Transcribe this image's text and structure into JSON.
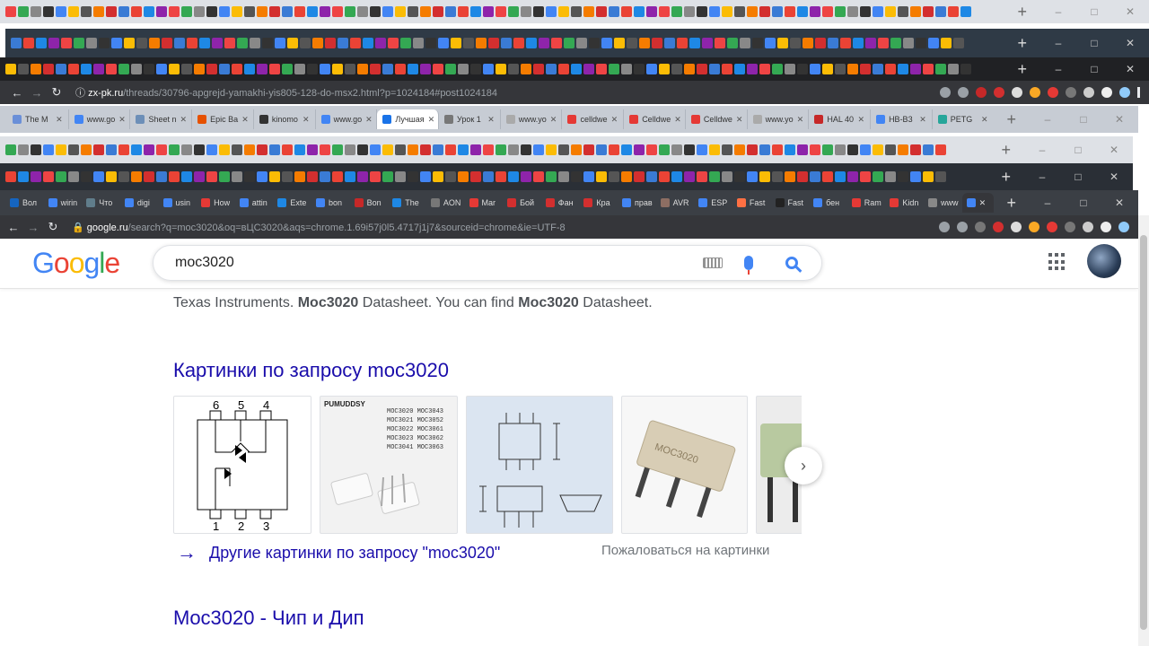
{
  "windows": {
    "top_strip_colors": [
      "#e44",
      "#3a7bd5",
      "#fbbc05",
      "#34a853",
      "#ea4335",
      "#555",
      "#888",
      "#1e88e5",
      "#f57c00",
      "#333",
      "#8e24aa",
      "#d32f2f",
      "#4285f4"
    ],
    "zxpk": {
      "url_host": "zx-pk.ru",
      "url_rest": "/threads/30796-apgrejd-yamakhi-yis805-128-do-msx2.html?p=1024184#post1024184"
    },
    "tabs_row": [
      {
        "label": "The M",
        "color": "#6a8fd8"
      },
      {
        "label": "www.go",
        "color": "#4285f4"
      },
      {
        "label": "Sheet n",
        "color": "#6d8fb8"
      },
      {
        "label": "Epic Ba",
        "color": "#e65100"
      },
      {
        "label": "kinomo",
        "color": "#333"
      },
      {
        "label": "www.go",
        "color": "#4285f4"
      },
      {
        "label": "Лучшая",
        "color": "#1a73e8",
        "active": true
      },
      {
        "label": "Урок 1",
        "color": "#777"
      },
      {
        "label": "www.yo",
        "color": "#aaa"
      },
      {
        "label": "celldwe",
        "color": "#e53935"
      },
      {
        "label": "Celldwe",
        "color": "#e53935"
      },
      {
        "label": "Celldwe",
        "color": "#e53935"
      },
      {
        "label": "www.yo",
        "color": "#aaa"
      },
      {
        "label": "HAL 40",
        "color": "#c62828"
      },
      {
        "label": "HB-B3",
        "color": "#4285f4"
      },
      {
        "label": "PETG",
        "color": "#26a69a"
      }
    ],
    "last_tabs": [
      {
        "label": "Вол",
        "color": "#1565c0"
      },
      {
        "label": "wirin",
        "color": "#4285f4"
      },
      {
        "label": "Что",
        "color": "#607d8b"
      },
      {
        "label": "digi",
        "color": "#4285f4"
      },
      {
        "label": "usin",
        "color": "#4285f4"
      },
      {
        "label": "How",
        "color": "#e53935"
      },
      {
        "label": "attin",
        "color": "#4285f4"
      },
      {
        "label": "Exte",
        "color": "#1e88e5"
      },
      {
        "label": "bon",
        "color": "#4285f4"
      },
      {
        "label": "Bon",
        "color": "#c62828"
      },
      {
        "label": "The",
        "color": "#1e88e5"
      },
      {
        "label": "AON",
        "color": "#777"
      },
      {
        "label": "Mar",
        "color": "#e53935"
      },
      {
        "label": "Бой",
        "color": "#d32f2f"
      },
      {
        "label": "Фан",
        "color": "#d32f2f"
      },
      {
        "label": "Кра",
        "color": "#d32f2f"
      },
      {
        "label": "прав",
        "color": "#4285f4"
      },
      {
        "label": "AVR",
        "color": "#8d6e63"
      },
      {
        "label": "ESP",
        "color": "#4285f4"
      },
      {
        "label": "Fast",
        "color": "#ff7043"
      },
      {
        "label": "Fast",
        "color": "#222"
      },
      {
        "label": "бен",
        "color": "#4285f4"
      },
      {
        "label": "Ram",
        "color": "#e53935"
      },
      {
        "label": "Kidn",
        "color": "#e53935"
      },
      {
        "label": "www",
        "color": "#888"
      }
    ],
    "google_url_host": "google.ru",
    "google_url_rest": "/search?q=moc3020&oq=вЦС3020&aqs=chrome.1.69i57j0l5.4717j1j7&sourceid=chrome&ie=UTF-8"
  },
  "google": {
    "logo": [
      "G",
      "o",
      "o",
      "g",
      "l",
      "e"
    ],
    "query": "moc3020",
    "snippet_pre": "Texas Instruments. ",
    "snippet_b1": "Moc3020",
    "snippet_mid": " Datasheet. You can find ",
    "snippet_b2": "Moc3020",
    "snippet_post": " Datasheet.",
    "images_heading": "Картинки по запросу moc3020",
    "thumb1_pins_top": [
      "6",
      "5",
      "4"
    ],
    "thumb1_pins_bottom": [
      "1",
      "2",
      "3"
    ],
    "thumb2_brand": "PUMUDDSY",
    "thumb2_parts": [
      "MOC3020 MOC3043",
      "MOC3021 MOC3052",
      "MOC3022 MOC3061",
      "MOC3023 MOC3062",
      "MOC3041 MOC3063"
    ],
    "thumb4_chip_text": "MOC3020",
    "more_images": "Другие картинки по запросу \"moc3020\"",
    "report_images": "Пожаловаться на картинки",
    "result_title": "Moc3020 - Чип и Дип"
  }
}
